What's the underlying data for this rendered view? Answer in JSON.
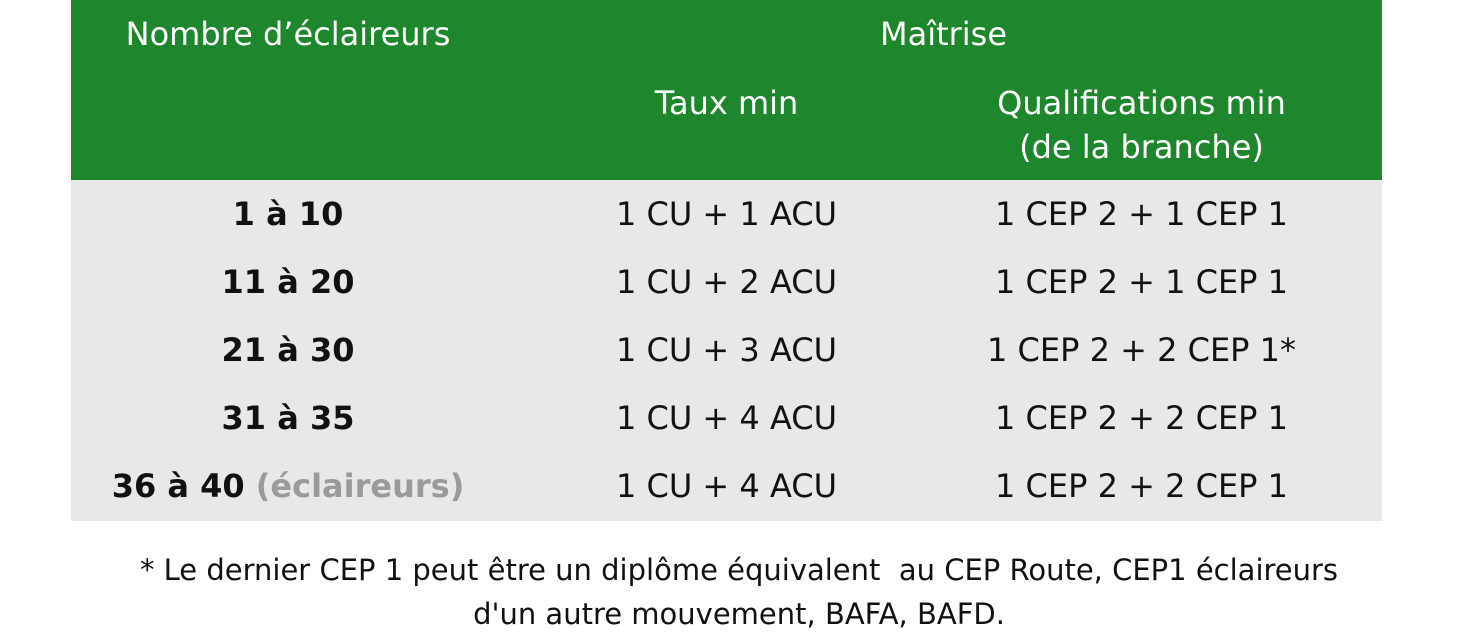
{
  "header": {
    "count_label": "Nombre d’éclaireurs",
    "group_label": "Maîtrise",
    "rate_label": "Taux min",
    "qualif_label_line1": "Qualifications min",
    "qualif_label_line2": "(de la branche)"
  },
  "rows": [
    {
      "count": "1 à 10",
      "count_suffix": "",
      "rate": "1 CU + 1 ACU",
      "qualif": "1 CEP 2 + 1 CEP 1"
    },
    {
      "count": "11 à 20",
      "count_suffix": "",
      "rate": "1 CU + 2 ACU",
      "qualif": "1 CEP 2 + 1 CEP 1"
    },
    {
      "count": "21 à 30",
      "count_suffix": "",
      "rate": "1 CU + 3 ACU",
      "qualif": "1 CEP 2 + 2 CEP 1*"
    },
    {
      "count": "31 à 35",
      "count_suffix": "",
      "rate": "1 CU + 4 ACU",
      "qualif": "1 CEP 2 + 2 CEP 1"
    },
    {
      "count": "36 à 40",
      "count_suffix": "(éclaireurs)",
      "rate": "1 CU + 4 ACU",
      "qualif": "1 CEP 2 + 2 CEP 1"
    }
  ],
  "footnote": {
    "line1": "* Le dernier CEP 1 peut être un diplôme équivalent  au CEP Route, CEP1 éclaireurs",
    "line2": "d'un autre mouvement, BAFA, BAFD."
  },
  "colors": {
    "header_bg": "#1e862c",
    "body_bg": "#e8e8e8",
    "muted_text": "#9a9a9a"
  }
}
